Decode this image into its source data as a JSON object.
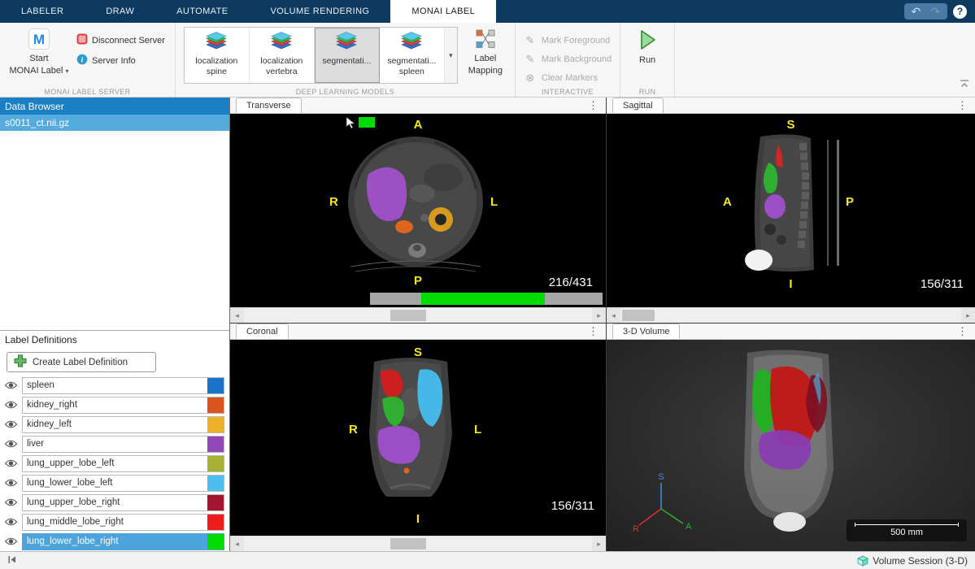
{
  "icons": {
    "kebab": "⋮",
    "dropdown": "▾",
    "scroll_left": "◂",
    "scroll_right": "▸",
    "undo": "↶",
    "redo": "↷",
    "help": "?",
    "mark_pen": "✎",
    "clear": "⊗"
  },
  "tabbar": {
    "tabs": [
      "LABELER",
      "DRAW",
      "AUTOMATE",
      "VOLUME RENDERING",
      "MONAI LABEL"
    ],
    "active_tab": "MONAI LABEL"
  },
  "ribbon": {
    "server": {
      "start_line1": "Start",
      "start_line2": "MONAI Label",
      "disconnect": "Disconnect Server",
      "info": "Server Info",
      "section": "MONAI LABEL SERVER"
    },
    "models": {
      "gallery": [
        {
          "line1": "localization",
          "line2": "spine"
        },
        {
          "line1": "localization",
          "line2": "vertebra"
        },
        {
          "line1": "segmentati...",
          "line2": ""
        },
        {
          "line1": "segmentati...",
          "line2": "spleen"
        }
      ],
      "mapping_line1": "Label",
      "mapping_line2": "Mapping",
      "section": "DEEP LEARNING MODELS"
    },
    "interactive": {
      "mark_foreground": "Mark Foreground",
      "mark_background": "Mark Background",
      "clear_markers": "Clear Markers",
      "section": "INTERACTIVE"
    },
    "run": {
      "button": "Run",
      "section": "RUN"
    }
  },
  "data_browser": {
    "title": "Data Browser",
    "file": "s0011_ct.nii.gz"
  },
  "label_definitions": {
    "title": "Label Definitions",
    "create_button": "Create Label Definition",
    "labels": [
      {
        "name": "spleen",
        "color": "#1a73c8"
      },
      {
        "name": "kidney_right",
        "color": "#d9541e"
      },
      {
        "name": "kidney_left",
        "color": "#edb02a"
      },
      {
        "name": "liver",
        "color": "#9348b8"
      },
      {
        "name": "lung_upper_lobe_left",
        "color": "#a6b135"
      },
      {
        "name": "lung_lower_lobe_left",
        "color": "#4dbeee"
      },
      {
        "name": "lung_upper_lobe_right",
        "color": "#a2142f"
      },
      {
        "name": "lung_middle_lobe_right",
        "color": "#ee1c1c"
      },
      {
        "name": "lung_lower_lobe_right",
        "color": "#00dc00"
      }
    ]
  },
  "viewports": {
    "transverse": {
      "tab": "Transverse",
      "top": "A",
      "left": "R",
      "right": "L",
      "bottom": "P",
      "slice": "216/431"
    },
    "sagittal": {
      "tab": "Sagittal",
      "top": "S",
      "left": "A",
      "right": "P",
      "bottom": "I",
      "slice": "156/311"
    },
    "coronal": {
      "tab": "Coronal",
      "top": "S",
      "left": "R",
      "right": "L",
      "bottom": "I",
      "slice": "156/311"
    },
    "volume": {
      "tab": "3-D Volume",
      "scale": "500 mm",
      "axis_s": "S",
      "axis_r": "R",
      "axis_a": "A"
    }
  },
  "statusbar": {
    "session": "Volume Session (3-D)"
  }
}
